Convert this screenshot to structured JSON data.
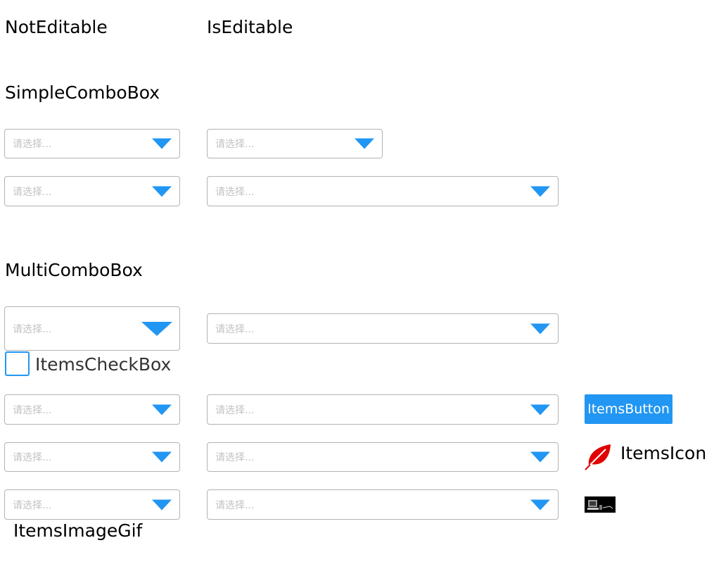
{
  "header": {
    "not_editable": "NotEditable",
    "is_editable": "IsEditable"
  },
  "sections": {
    "simple": "SimpleComboBox",
    "multi": "MultiComboBox"
  },
  "combo": {
    "placeholder": "请选择..."
  },
  "items": {
    "checkbox_label": "ItemsCheckBox",
    "button_label": "ItemsButton",
    "icon_label": "ItemsIcon",
    "imagegif_label": "ItemsImageGif"
  },
  "colors": {
    "accent": "#2196f3",
    "leaf_icon": "#e00000",
    "border": "#b3b3b3",
    "placeholder": "#c2c2c2"
  },
  "icons": {
    "dropdown": "chevron-down-icon",
    "leaf": "leaf-icon",
    "gif": "computer-gif-icon"
  }
}
